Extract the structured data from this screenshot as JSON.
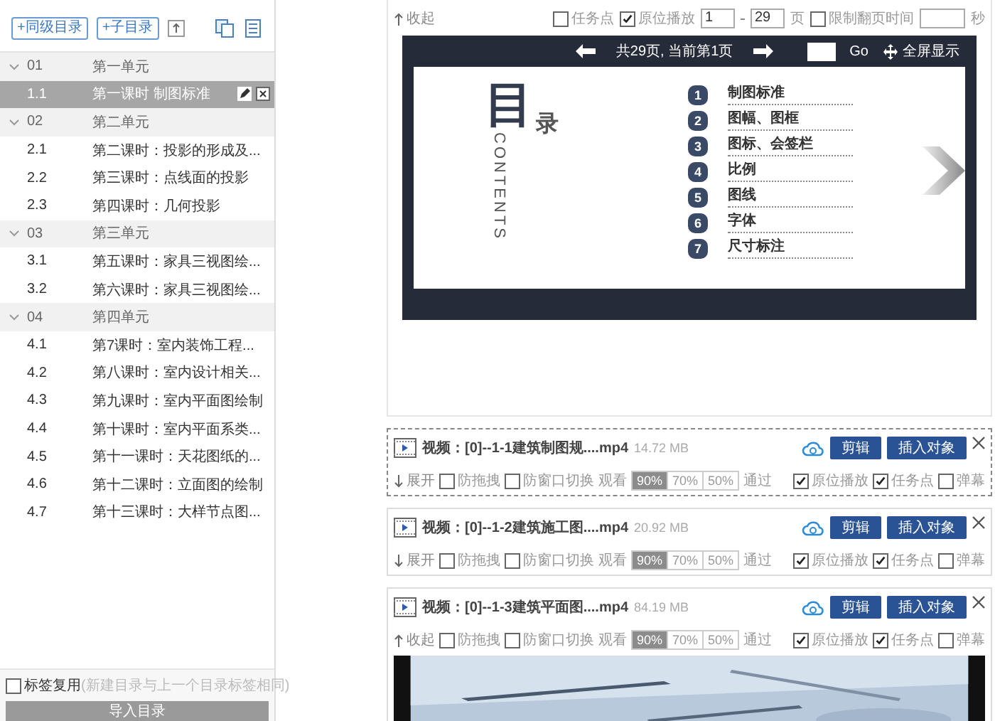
{
  "toolbar": {
    "buttons": [
      {
        "label": "+同级目录"
      },
      {
        "label": "+子目录"
      }
    ]
  },
  "tree": [
    {
      "number": "01",
      "title": "第一单元",
      "expanded": true,
      "children": [
        {
          "number": "1.1",
          "title": "第一课时 制图标准",
          "selected": true
        }
      ]
    },
    {
      "number": "02",
      "title": "第二单元",
      "expanded": true,
      "children": [
        {
          "number": "2.1",
          "title": "第二课时：投影的形成及...",
          "selected": false
        },
        {
          "number": "2.2",
          "title": "第三课时：点线面的投影",
          "selected": false
        },
        {
          "number": "2.3",
          "title": "第四课时：几何投影",
          "selected": false
        }
      ]
    },
    {
      "number": "03",
      "title": "第三单元",
      "expanded": true,
      "children": [
        {
          "number": "3.1",
          "title": "第五课时：家具三视图绘...",
          "selected": false
        },
        {
          "number": "3.2",
          "title": "第六课时：家具三视图绘...",
          "selected": false
        }
      ]
    },
    {
      "number": "04",
      "title": "第四单元",
      "expanded": true,
      "children": [
        {
          "number": "4.1",
          "title": "第7课时：室内装饰工程...",
          "selected": false
        },
        {
          "number": "4.2",
          "title": "第八课时：室内设计相关...",
          "selected": false
        },
        {
          "number": "4.3",
          "title": "第九课时：室内平面图绘制",
          "selected": false
        },
        {
          "number": "4.4",
          "title": "第十课时：室内平面系类...",
          "selected": false
        },
        {
          "number": "4.5",
          "title": "第十一课时：天花图纸的...",
          "selected": false
        },
        {
          "number": "4.6",
          "title": "第十二课时：立面图的绘制",
          "selected": false
        },
        {
          "number": "4.7",
          "title": "第十三课时：大样节点图...",
          "selected": false
        }
      ]
    }
  ],
  "footer": {
    "reuse_label": "标签复用",
    "reuse_hint": "(新建目录与上一个目录标签相同)",
    "reuse_checked": false,
    "import_button": "导入目录"
  },
  "slide_settings": {
    "toggle": "收起",
    "options": [
      {
        "label": "任务点",
        "checked": false
      },
      {
        "label": "原位播放",
        "checked": true
      }
    ],
    "page_from": "1",
    "page_to": "29",
    "page_unit": "页",
    "limit_label": "限制翻页时间",
    "limit_checked": false,
    "seconds_unit": "秒"
  },
  "viewer": {
    "page_info": "共29页, 当前第1页",
    "go": "Go",
    "fullscreen": "全屏显示",
    "slide": {
      "title_big": "目",
      "title_small": "录",
      "subtitle": "CONTENTS",
      "items": [
        {
          "number": "1",
          "label": "制图标准"
        },
        {
          "number": "2",
          "label": "图幅、图框"
        },
        {
          "number": "3",
          "label": "图标、会签栏"
        },
        {
          "number": "4",
          "label": "比例"
        },
        {
          "number": "5",
          "label": "图线"
        },
        {
          "number": "6",
          "label": "字体"
        },
        {
          "number": "7",
          "label": "尺寸标注"
        }
      ]
    }
  },
  "videos": [
    {
      "title": "视频：[0]--1-1建筑制图规....mp4",
      "size": "14.72 MB",
      "edit": "剪辑",
      "insert": "插入对象",
      "toggle": "展开",
      "expanded": false,
      "highlighted": true,
      "options": [
        {
          "label": "防拖拽",
          "checked": false
        },
        {
          "label": "防窗口切换",
          "checked": false
        }
      ],
      "watch": "观看",
      "thresholds": [
        {
          "label": "90%",
          "selected": true
        },
        {
          "label": "70%",
          "selected": false
        },
        {
          "label": "50%",
          "selected": false
        }
      ],
      "pass": "通过",
      "flags": [
        {
          "label": "原位播放",
          "checked": true
        },
        {
          "label": "任务点",
          "checked": true
        },
        {
          "label": "弹幕",
          "checked": false
        }
      ]
    },
    {
      "title": "视频：[0]--1-2建筑施工图....mp4",
      "size": "20.92 MB",
      "edit": "剪辑",
      "insert": "插入对象",
      "toggle": "展开",
      "expanded": false,
      "highlighted": false,
      "options": [
        {
          "label": "防拖拽",
          "checked": false
        },
        {
          "label": "防窗口切换",
          "checked": false
        }
      ],
      "watch": "观看",
      "thresholds": [
        {
          "label": "90%",
          "selected": true
        },
        {
          "label": "70%",
          "selected": false
        },
        {
          "label": "50%",
          "selected": false
        }
      ],
      "pass": "通过",
      "flags": [
        {
          "label": "原位播放",
          "checked": true
        },
        {
          "label": "任务点",
          "checked": true
        },
        {
          "label": "弹幕",
          "checked": false
        }
      ]
    },
    {
      "title": "视频：[0]--1-3建筑平面图....mp4",
      "size": "84.19 MB",
      "edit": "剪辑",
      "insert": "插入对象",
      "toggle": "收起",
      "expanded": true,
      "highlighted": false,
      "options": [
        {
          "label": "防拖拽",
          "checked": false
        },
        {
          "label": "防窗口切换",
          "checked": false
        }
      ],
      "watch": "观看",
      "thresholds": [
        {
          "label": "90%",
          "selected": true
        },
        {
          "label": "70%",
          "selected": false
        },
        {
          "label": "50%",
          "selected": false
        }
      ],
      "pass": "通过",
      "flags": [
        {
          "label": "原位播放",
          "checked": true
        },
        {
          "label": "任务点",
          "checked": true
        },
        {
          "label": "弹幕",
          "checked": false
        }
      ]
    }
  ]
}
